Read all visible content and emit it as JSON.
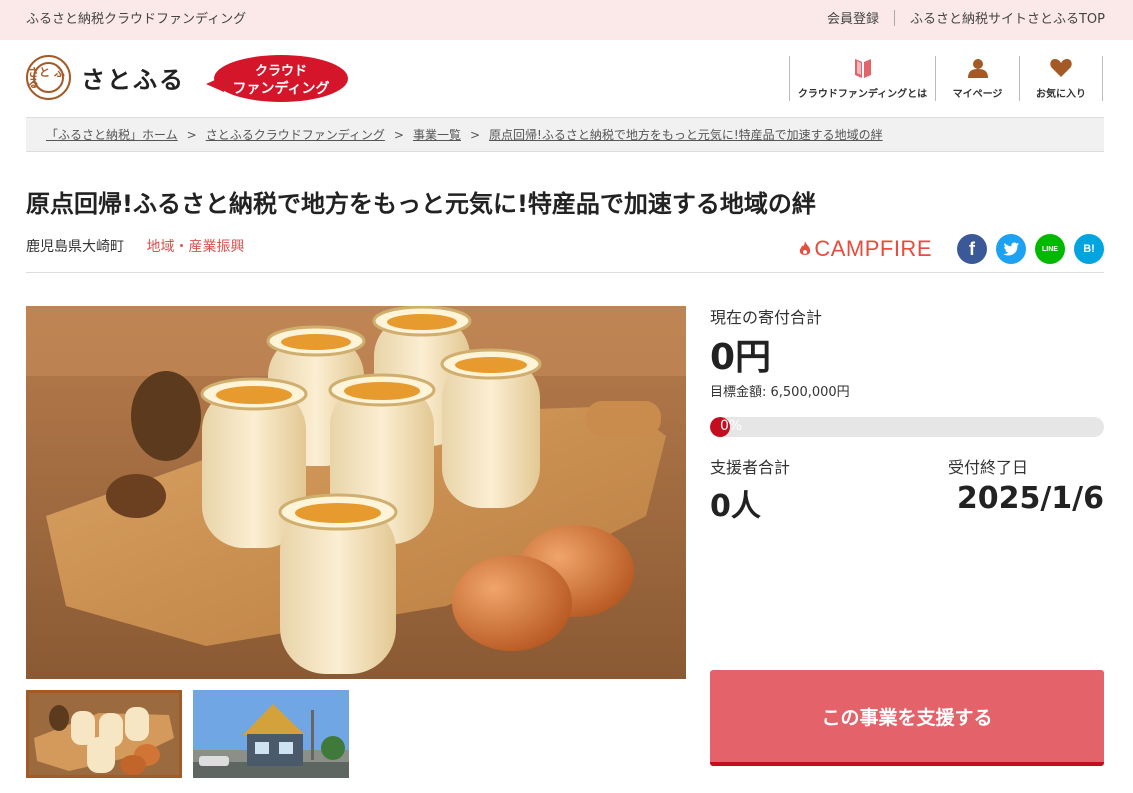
{
  "topbar": {
    "tagline": "ふるさと納税クラウドファンディング",
    "links": [
      "会員登録",
      "ふるさと納税サイトさとふるTOP"
    ]
  },
  "header": {
    "logo_mark": "さと ふる",
    "logo_text": "さとふる",
    "badge_line1": "クラウド",
    "badge_line2": "ファンディング",
    "nav": [
      {
        "label": "クラウドファンディングとは",
        "icon": "book-icon"
      },
      {
        "label": "マイページ",
        "icon": "person-icon"
      },
      {
        "label": "お気に入り",
        "icon": "heart-icon"
      }
    ]
  },
  "breadcrumb": [
    "「ふるさと納税」ホーム",
    "さとふるクラウドファンディング",
    "事業一覧",
    "原点回帰!ふるさと納税で地方をもっと元気に!特産品で加速する地域の絆"
  ],
  "project": {
    "title": "原点回帰!ふるさと納税で地方をもっと元気に!特産品で加速する地域の絆",
    "location": "鹿児島県大崎町",
    "category": "地域・産業振興"
  },
  "share": {
    "campfire": "CAMPFIRE",
    "icons": [
      {
        "name": "facebook-icon",
        "glyph": "f",
        "color": "#3b5998"
      },
      {
        "name": "twitter-icon",
        "glyph": "",
        "color": "#1da1f2"
      },
      {
        "name": "line-icon",
        "glyph": "LINE",
        "color": "#00b900"
      },
      {
        "name": "hatena-icon",
        "glyph": "B!",
        "color": "#00a4de"
      }
    ]
  },
  "stats": {
    "current_label": "現在の寄付合計",
    "current_value": "0円",
    "goal": "目標金額: 6,500,000円",
    "progress_percent": 0,
    "progress_text": "0%",
    "supporters_label": "支援者合計",
    "supporters_value": "0人",
    "deadline_label": "受付終了日",
    "deadline_value": "2025/1/6"
  },
  "cta": {
    "label": "この事業を支援する"
  }
}
